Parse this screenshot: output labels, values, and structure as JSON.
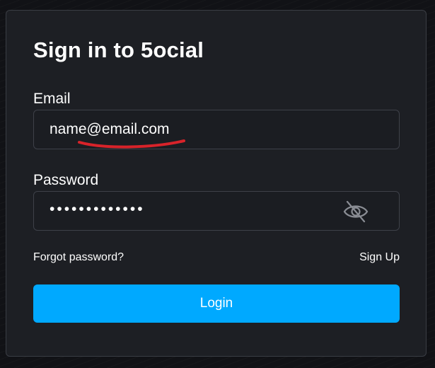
{
  "form": {
    "title": "Sign in to 5ocial",
    "email": {
      "label": "Email",
      "value": "name@email.com"
    },
    "password": {
      "label": "Password",
      "masked_value": "•••••••••••••",
      "toggle_icon": "eye-slash-icon"
    },
    "forgot_password_label": "Forgot password?",
    "sign_up_label": "Sign Up",
    "login_label": "Login"
  },
  "colors": {
    "background": "#111216",
    "card": "#1d1f24",
    "accent": "#00a9ff",
    "annotation": "#d8232a"
  }
}
